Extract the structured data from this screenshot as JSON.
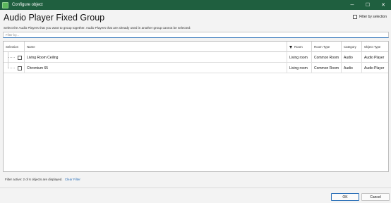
{
  "window": {
    "title": "Configure object",
    "minimize_glyph": "─",
    "maximize_glyph": "☐",
    "close_glyph": "✕"
  },
  "dialog": {
    "heading": "Audio Player Fixed Group",
    "subtitle": "Select the Audio Players that you want to group together. Audio Players that are already used in another group cannot be selected:",
    "filter_by_selection_label": "Filter by selection",
    "filter_by_selection_checked": false,
    "filter_placeholder": "Filter by..."
  },
  "table": {
    "columns": {
      "selection": "Selection",
      "name": "Name",
      "room": "Room",
      "room_type": "Room Type",
      "category": "Category",
      "object_type": "Object Type"
    },
    "room_filter_active": true,
    "rows": [
      {
        "selected": false,
        "name": "Living Room Ceiling",
        "room": "Living room",
        "room_type": "Common Room",
        "category": "Audio",
        "object_type": "Audio Player"
      },
      {
        "selected": false,
        "name": "Chromium 65",
        "room": "Living room",
        "room_type": "Common Room",
        "category": "Audio",
        "object_type": "Audio Player"
      }
    ]
  },
  "status": {
    "text": "Filter active: 2 of 6 objects are displayed.",
    "clear_filter_label": "Clear Filter"
  },
  "buttons": {
    "ok": "OK",
    "cancel": "Cancel"
  },
  "colors": {
    "titlebar": "#1f5f3f",
    "accent": "#2a6fb7"
  }
}
